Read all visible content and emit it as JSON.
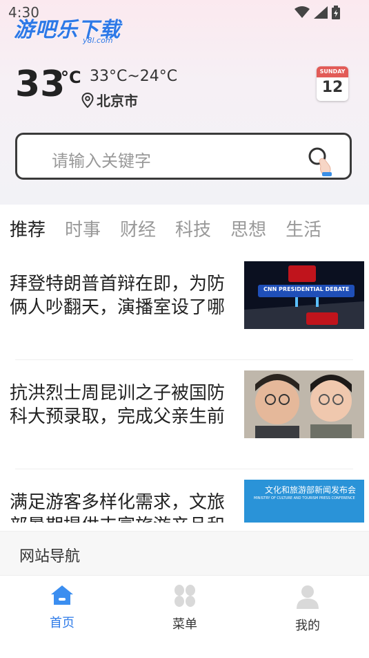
{
  "status": {
    "time": "4:30"
  },
  "header": {
    "logo_text": "游吧乐下载",
    "logo_sub": "y8l.com"
  },
  "weather": {
    "temp": "33",
    "unit": "°C",
    "range": "33°C~24°C",
    "city": "北京市"
  },
  "calendar": {
    "month_label": "SUNDAY",
    "day": "12"
  },
  "search": {
    "placeholder": "请输入关键字"
  },
  "tabs": [
    {
      "label": "推荐",
      "active": true
    },
    {
      "label": "时事"
    },
    {
      "label": "财经"
    },
    {
      "label": "科技"
    },
    {
      "label": "思想"
    },
    {
      "label": "生活"
    }
  ],
  "news": [
    {
      "title": "拜登特朗普首辩在即，为防俩人吵翻天，演播室设了哪",
      "image_text": "CNN PRESIDENTIAL DEBATE"
    },
    {
      "title": "抗洪烈士周昆训之子被国防科大预录取，完成父亲生前"
    },
    {
      "title": "满足游客多样化需求，文旅部暑期提供丰富旅游产品和",
      "image_text": "文化和旅游部新闻发布会",
      "image_subtext": "MINISTRY OF CULTURE AND TOURISM PRESS CONFERENCE"
    }
  ],
  "site_nav": {
    "label": "网站导航"
  },
  "bottom_nav": [
    {
      "label": "首页",
      "icon": "home-icon",
      "active": true
    },
    {
      "label": "菜单",
      "icon": "menu-grid-icon"
    },
    {
      "label": "我的",
      "icon": "user-icon"
    }
  ],
  "colors": {
    "accent": "#2f7be8",
    "text": "#222222",
    "muted": "#999999"
  }
}
